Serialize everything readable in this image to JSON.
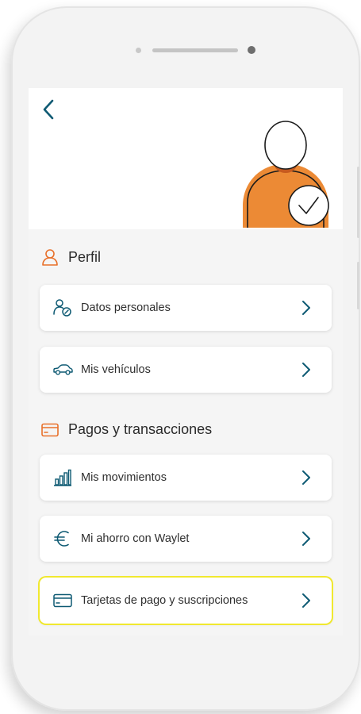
{
  "colors": {
    "accent_orange": "#e8702a",
    "avatar_orange": "#ec8a35",
    "icon_blue": "#0e5a73",
    "highlight_yellow": "#f0e82f"
  },
  "header": {
    "back_icon": "chevron-left-icon",
    "avatar_icon": "verified-user-avatar"
  },
  "sections": [
    {
      "title": "Perfil",
      "icon": "user-icon",
      "items": [
        {
          "label": "Datos personales",
          "icon": "user-settings-icon"
        },
        {
          "label": "Mis vehículos",
          "icon": "car-icon"
        }
      ]
    },
    {
      "title": "Pagos y transacciones",
      "icon": "card-icon",
      "items": [
        {
          "label": "Mis movimientos",
          "icon": "bar-chart-icon"
        },
        {
          "label": "Mi ahorro con Waylet",
          "icon": "euro-icon"
        },
        {
          "label": "Tarjetas de pago y suscripciones",
          "icon": "credit-card-icon",
          "highlighted": true
        }
      ]
    }
  ]
}
